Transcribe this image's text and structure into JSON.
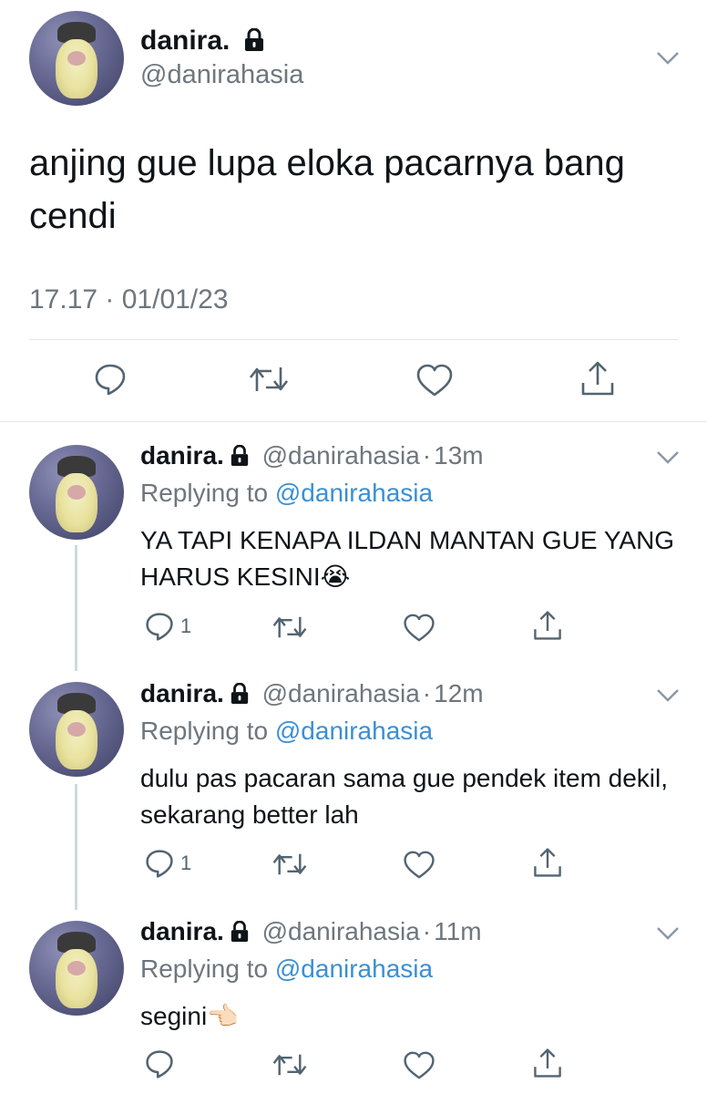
{
  "main_tweet": {
    "display_name": "danira.",
    "handle": "@danirahasia",
    "text": "anjing gue lupa eloka pacarnya bang cendi",
    "timestamp": "17.17 · 01/01/23",
    "icons": [
      "reply-icon",
      "retweet-icon",
      "like-icon",
      "share-icon"
    ]
  },
  "replies": [
    {
      "display_name": "danira.",
      "handle": "@danirahasia",
      "time": "13m",
      "replying_prefix": "Replying to",
      "replying_to": "@danirahasia",
      "text": "YA TAPI KENAPA ILDAN MANTAN GUE YANG HARUS KESINI😭",
      "reply_count": "1"
    },
    {
      "display_name": "danira.",
      "handle": "@danirahasia",
      "time": "12m",
      "replying_prefix": "Replying to",
      "replying_to": "@danirahasia",
      "text": "dulu pas pacaran sama gue pendek item dekil, sekarang better lah",
      "reply_count": "1"
    },
    {
      "display_name": "danira.",
      "handle": "@danirahasia",
      "time": "11m",
      "replying_prefix": "Replying to",
      "replying_to": "@danirahasia",
      "text": "segini👈🏻",
      "reply_count": ""
    }
  ],
  "separator": "·",
  "colors": {
    "link": "#3b8fd4",
    "muted": "#6e767d",
    "text": "#0f1419",
    "divider": "#e3e6e8"
  }
}
